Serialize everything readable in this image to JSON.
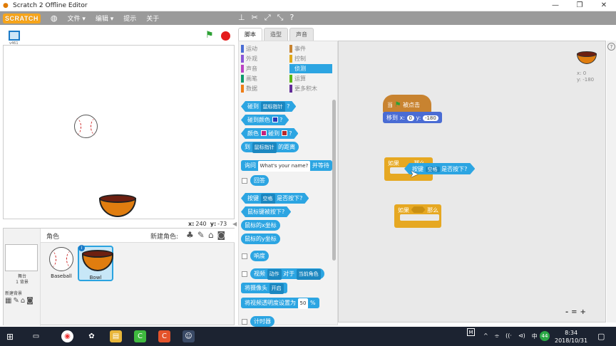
{
  "window": {
    "title": "Scratch 2 Offline Editor",
    "controls": [
      "—",
      "❐",
      "✕"
    ]
  },
  "menubar": {
    "logo": "SCRATCH",
    "menus": [
      "文件 ▾",
      "编辑 ▾",
      "提示",
      "关于"
    ],
    "tools": [
      "stamp-icon",
      "cut-icon",
      "grow-icon",
      "shrink-icon",
      "help-icon"
    ]
  },
  "stage_header": {
    "version": "v461"
  },
  "stage_coords": {
    "x_label": "x:",
    "x": "240",
    "y_label": "y:",
    "y": "-73"
  },
  "sprites_pane": {
    "title": "角色",
    "new_sprite_label": "新建角色:",
    "stage_label": "舞台",
    "backdrops_count": "1 背景",
    "new_backdrop_label": "新建背景",
    "sprites": [
      {
        "name": "Baseball",
        "selected": false
      },
      {
        "name": "Bowl",
        "selected": true
      }
    ]
  },
  "tabs": [
    "脚本",
    "造型",
    "声音"
  ],
  "categories": [
    {
      "label": "运动",
      "color": "#4a6cd4"
    },
    {
      "label": "事件",
      "color": "#c88330"
    },
    {
      "label": "外观",
      "color": "#8a55d7"
    },
    {
      "label": "控制",
      "color": "#e1a91a"
    },
    {
      "label": "声音",
      "color": "#bb42c3"
    },
    {
      "label": "侦测",
      "color": "#2ca5e2",
      "active": true
    },
    {
      "label": "画笔",
      "color": "#0e9a6c"
    },
    {
      "label": "运算",
      "color": "#5cb712"
    },
    {
      "label": "数据",
      "color": "#ee7d16"
    },
    {
      "label": "更多积木",
      "color": "#632d99"
    }
  ],
  "palette_blocks": {
    "touching": "碰到",
    "touching_target": "鼠标指针",
    "touching_color": "碰到颜色",
    "color_label": "颜色",
    "touching_label": "碰到",
    "distance_to": "到",
    "distance_target": "鼠标指针",
    "distance_label": "的距离",
    "ask_label": "询问",
    "ask_value": "What's your name?",
    "ask_wait": "并等待",
    "answer": "回答",
    "key_label": "按键",
    "key_value": "空格",
    "key_pressed": "是否按下?",
    "mouse_down": "鼠标键被按下?",
    "mouse_x": "鼠标的x坐标",
    "mouse_y": "鼠标的y坐标",
    "loudness": "响度",
    "video_label": "视频",
    "video_attr": "动作",
    "video_on": "对于",
    "video_target": "当前角色",
    "turn_video": "将摄像头",
    "turn_video_state": "开启",
    "set_transparency": "将视频透明度设置为",
    "transparency_value": "50",
    "transparency_unit": "%",
    "timer": "计时器",
    "question_mark": "?"
  },
  "scripts": {
    "hat_when": "当",
    "hat_clicked": "被点击",
    "goto_label": "移到 x:",
    "goto_x": "0",
    "goto_y_label": "y:",
    "goto_y": "-180",
    "if1_label": "如果",
    "if1_then": "那么",
    "key_label": "按键",
    "key_value": "空格",
    "key_pressed": "是否按下?",
    "if2_label": "如果",
    "if2_then": "那么",
    "sprite_x": "x: 0",
    "sprite_y": "y: -180",
    "zoom": [
      "-",
      "=",
      "+"
    ]
  },
  "taskbar": {
    "ime": "M",
    "tray": [
      "^",
      "⌯",
      "((·",
      "⊲)",
      "中"
    ],
    "badge": "44",
    "time": "8:34",
    "date": "2018/10/31"
  }
}
